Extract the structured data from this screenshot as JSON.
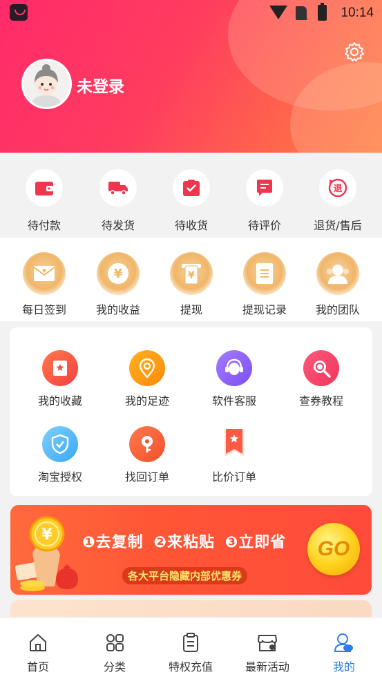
{
  "status_bar": {
    "time": "10:14"
  },
  "header": {
    "login_text": "未登录"
  },
  "orders": [
    {
      "label": "待付款",
      "icon": "wallet-icon"
    },
    {
      "label": "待发货",
      "icon": "truck-icon"
    },
    {
      "label": "待收货",
      "icon": "received-box-icon"
    },
    {
      "label": "待评价",
      "icon": "comment-icon"
    },
    {
      "label": "退货/售后",
      "icon": "return-icon",
      "icon_text": "退"
    }
  ],
  "benefits": [
    {
      "label": "每日签到",
      "icon": "envelope-icon"
    },
    {
      "label": "我的收益",
      "icon": "yuan-coin-icon",
      "icon_text": "¥"
    },
    {
      "label": "提现",
      "icon": "withdraw-icon",
      "icon_text": "¥"
    },
    {
      "label": "提现记录",
      "icon": "record-icon"
    },
    {
      "label": "我的团队",
      "icon": "team-icon"
    }
  ],
  "services": [
    {
      "label": "我的收藏",
      "icon": "favorite-icon"
    },
    {
      "label": "我的足迹",
      "icon": "location-icon"
    },
    {
      "label": "软件客服",
      "icon": "customer-service-icon"
    },
    {
      "label": "查券教程",
      "icon": "search-coupon-icon"
    },
    {
      "label": "淘宝授权",
      "icon": "shield-check-icon"
    },
    {
      "label": "找回订单",
      "icon": "key-icon"
    },
    {
      "label": "比价订单",
      "icon": "bookmark-star-icon"
    }
  ],
  "banner": {
    "step1": "❶去复制",
    "step2": "❷来粘贴",
    "step3": "❸立即省",
    "subtitle": "各大平台隐藏内部优惠券",
    "go_label": "GO",
    "coin_symbol": "¥"
  },
  "tabs": [
    {
      "label": "首页",
      "icon": "home-icon",
      "active": false
    },
    {
      "label": "分类",
      "icon": "category-icon",
      "active": false
    },
    {
      "label": "特权充值",
      "icon": "clipboard-icon",
      "active": false
    },
    {
      "label": "最新活动",
      "icon": "store-icon",
      "active": false
    },
    {
      "label": "我的",
      "icon": "profile-icon",
      "active": true
    }
  ],
  "colors": {
    "accent": "#ff3d5e",
    "active_tab": "#2b7de9",
    "gold": "#f0b66a"
  }
}
